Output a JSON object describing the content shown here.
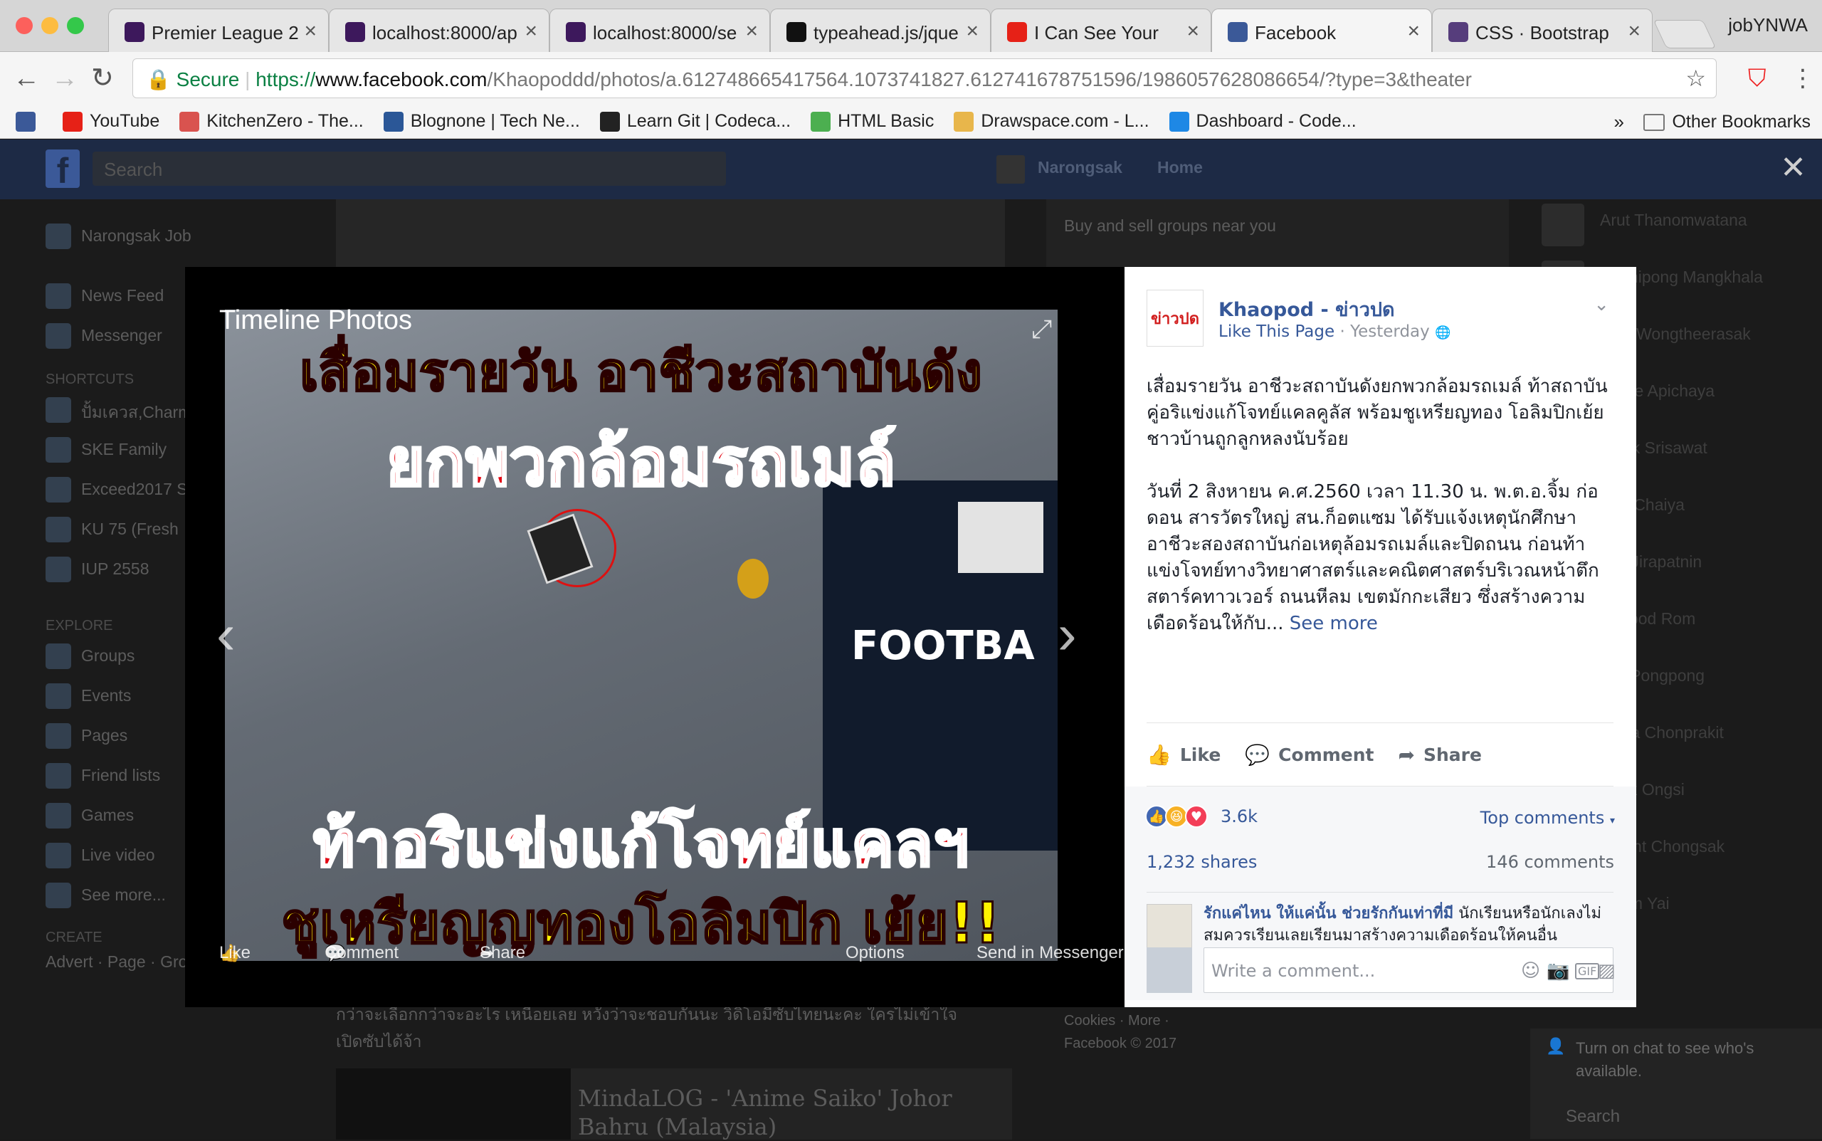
{
  "browser": {
    "profile": "jobYNWA",
    "tabs": [
      {
        "title": "Premier League 2",
        "favicon": "premier-league-icon",
        "color": "#3d185c"
      },
      {
        "title": "localhost:8000/ap",
        "favicon": "premier-league-icon",
        "color": "#3d185c"
      },
      {
        "title": "localhost:8000/se",
        "favicon": "premier-league-icon",
        "color": "#3d185c"
      },
      {
        "title": "typeahead.js/jque",
        "favicon": "github-icon",
        "color": "#111111"
      },
      {
        "title": "I Can See Your",
        "favicon": "youtube-icon",
        "color": "#e62117"
      },
      {
        "title": "Facebook",
        "favicon": "facebook-icon",
        "color": "#3b5998",
        "active": true
      },
      {
        "title": "CSS · Bootstrap",
        "favicon": "bootstrap-icon",
        "color": "#563d7c"
      }
    ],
    "secure_label": "Secure",
    "url_scheme": "https://",
    "url_host": "www.facebook.com",
    "url_path": "/Khaopoddd/photos/a.612748665417564.1073741827.612741678751596/1986057628086654/?type=3&theater",
    "bookmarks": [
      {
        "label": "",
        "icon": "facebook-icon",
        "color": "#3b5998"
      },
      {
        "label": "YouTube",
        "icon": "youtube-icon",
        "color": "#e62117"
      },
      {
        "label": "KitchenZero - The...",
        "icon": "k-icon",
        "color": "#d9534f"
      },
      {
        "label": "Blognone | Tech Ne...",
        "icon": "bn-icon",
        "color": "#2b5797"
      },
      {
        "label": "Learn Git | Codeca...",
        "icon": "codecademy-icon",
        "color": "#222222"
      },
      {
        "label": "HTML Basic",
        "icon": "w3-icon",
        "color": "#4caf50"
      },
      {
        "label": "Drawspace.com - L...",
        "icon": "pencil-icon",
        "color": "#e8b64b"
      },
      {
        "label": "Dashboard - Code...",
        "icon": "code-icon",
        "color": "#1e88e5"
      }
    ],
    "bookmarks_more": "»",
    "other_bookmarks": "Other Bookmarks"
  },
  "fb_bg": {
    "search_placeholder": "Search",
    "user_name": "Narongsak",
    "home": "Home",
    "left_nav": [
      "Narongsak Job",
      "News Feed",
      "Messenger"
    ],
    "shortcuts_head": "SHORTCUTS",
    "shortcuts": [
      "ปั้มเควส,Charm",
      "SKE Family",
      "Exceed2017 S",
      "KU 75 (Fresh",
      "IUP 2558"
    ],
    "explore_head": "EXPLORE",
    "explore": [
      "Groups",
      "Events",
      "Pages",
      "Friend lists",
      "Games",
      "Live video",
      "See more..."
    ],
    "create_head": "CREATE",
    "create_links": "Advert · Page · Gro",
    "right_header": "Buy and sell groups near you",
    "contacts": [
      "Arut Thanomwatana",
      "Sutthipong Mangkhala",
      "Ploy Wongtheerasak",
      "Jamie Apichaya",
      "Mook Srisawat",
      "Pao Chaiya",
      "Tan Jirapatnin",
      "Kaopod Rom",
      "Nut Pongpong",
      "Maya Chonprakit",
      "Bank Ongsi",
      "Knight Chongsak",
      "Boom Yai"
    ],
    "center_text": "กว่าจะเลือกกว่าจะอะไร เหนื่อยเลย หวังว่าจะชอบกันนะ วิดิโอมีซับไทยนะคะ ใครไม่เข้าใจ เปิดซับได้จ้า",
    "center_card": "MindaLOG - 'Anime Saiko' Johor Bahru (Malaysia)",
    "footer": "Cookies · More · Facebook © 2017",
    "chat_hint": "Turn on chat to see who's available.",
    "chat_search": "Search"
  },
  "lightbox": {
    "title": "Timeline Photos",
    "image_lines": [
      "เสื่อมรายวัน อาชีวะสถาบันดัง",
      "ยกพวกล้อมรถเมล์",
      "FOOTBA",
      "ท้าอริแข่งแก้โจทย์แคลฯ",
      "ชูเหรียญญทองโอลิมปิก เย้ย!!"
    ],
    "prev_arrow": "‹",
    "next_arrow": "›",
    "like": "Like",
    "comment": "Comment",
    "share": "Share",
    "options": "Options",
    "send": "Send in Messenger",
    "close": "✕"
  },
  "post": {
    "avatar_text": "ข่าวปด",
    "page_name": "Khaopod - ข่าวปด",
    "like_page": "Like This Page",
    "sep": " · ",
    "time": "Yesterday",
    "globe": "🌐",
    "para1": "เสื่อมรายวัน อาชีวะสถาบันดังยกพวกล้อมรถเมล์ ท้าสถาบันคู่อริแข่งแก้โจทย์แคลคูลัส พร้อมชูเหรียญทอง โอลิมปิกเย้ย ชาวบ้านถูกลูกหลงนับร้อย",
    "para2": "วันที่ 2 สิงหายน ค.ศ.2560 เวลา 11.30 น. พ.ต.อ.จิ้ม ก่อดอน สารวัตรใหญ่ สน.ก็อตแซม ได้รับแจ้งเหตุนักศึกษาอาชีวะสองสถาบันก่อเหตุล้อมรถเมล์และปิดถนน ก่อนท้าแข่งโจทย์ทางวิทยาศาสตร์และคณิตศาสตร์บริเวณหน้าตึกสตาร์คทาวเวอร์ ถนนหีลม เขตมักกะเสียว ซึ่งสร้างความเดือดร้อนให้กับ...",
    "see_more": "See more",
    "like": "Like",
    "comment": "Comment",
    "share": "Share",
    "reaction_count": "3.6k",
    "top_comments": "Top comments",
    "shares": "1,232 shares",
    "comments": "146 comments",
    "fc_name": "รักแค่ไหน ให้แค่นั้น ช่วยรักกันเท่าที่มี",
    "fc_text": "นักเรียนหรือนักเลงไม่สมควรเรียนเลยเรียนมาสร้างความเดือดร้อนให้คนอื่น",
    "write_placeholder": "Write a comment..."
  },
  "colors": {
    "fb_blue": "#365899",
    "fb_nav": "#3b5998",
    "secure_green": "#0b8043",
    "image_red": "#e30613",
    "image_yellow": "#fff200"
  }
}
